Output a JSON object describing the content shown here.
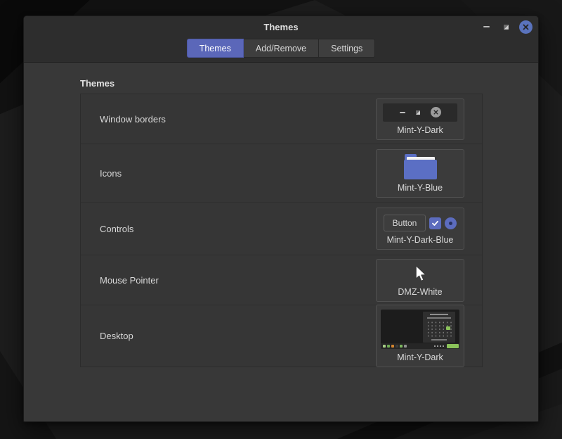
{
  "window": {
    "title": "Themes"
  },
  "tabs": [
    {
      "label": "Themes",
      "active": true
    },
    {
      "label": "Add/Remove",
      "active": false
    },
    {
      "label": "Settings",
      "active": false
    }
  ],
  "content": {
    "section_header": "Themes",
    "rows": [
      {
        "label": "Window borders",
        "theme_name": "Mint-Y-Dark"
      },
      {
        "label": "Icons",
        "theme_name": "Mint-Y-Blue"
      },
      {
        "label": "Controls",
        "theme_name": "Mint-Y-Dark-Blue",
        "sample_button_label": "Button"
      },
      {
        "label": "Mouse Pointer",
        "theme_name": "DMZ-White"
      },
      {
        "label": "Desktop",
        "theme_name": "Mint-Y-Dark"
      }
    ]
  },
  "icons": {
    "titlebar": [
      "minimize-icon",
      "maximize-icon",
      "close-icon"
    ],
    "window_border_preview": [
      "minimize-icon",
      "maximize-icon",
      "close-icon"
    ],
    "controls_preview": [
      "checkbox-checked-icon",
      "radio-selected-icon"
    ],
    "mouse_preview": "arrow-cursor-icon",
    "icons_preview": "folder-icon"
  },
  "colors": {
    "accent_blue": "#5b67b9",
    "close_button_blue": "#5a73bd",
    "control_blue": "#5c6cbe",
    "folder_blue": "#5b6fc4",
    "mint_green": "#8bc35a",
    "titlebar_bg": "#2d2d2d",
    "content_bg": "#383838",
    "list_bg": "#363636"
  }
}
